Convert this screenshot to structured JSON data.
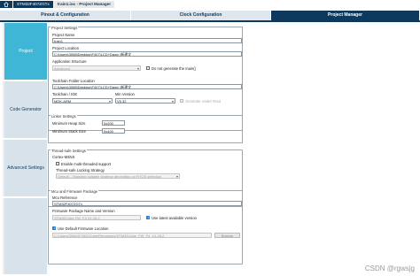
{
  "breadcrumb": {
    "device": "STM32F407ZGTx",
    "page": "train1.ioc - Project Manager"
  },
  "tabs": [
    {
      "label": "Pinout & Configuration"
    },
    {
      "label": "Clock Configuration"
    },
    {
      "label": "Project Manager"
    }
  ],
  "sidebar": {
    "items": [
      {
        "label": "Project"
      },
      {
        "label": "Code Generator"
      },
      {
        "label": "Advanced Settings"
      }
    ]
  },
  "project_settings": {
    "title": "Project Settings",
    "name_label": "Project Name",
    "name_value": "train1",
    "location_label": "Project Location",
    "location_value": "C:\\Users\\3068\\Desktop\\F407\\LCD+Dawy  \\新建文",
    "structure_label": "Application Structure",
    "structure_value": "Advanced",
    "no_main_label": "Do not generate the main()",
    "toolchain_folder_label": "Toolchain Folder Location",
    "toolchain_folder_value": "C:\\Users\\3068\\Desktop\\F407\\LCD+Dawy  \\新建文",
    "ide_label": "Toolchain / IDE",
    "ide_value": "MDK-ARM",
    "min_version_label": "Min Version",
    "min_version_value": "V5.32",
    "gen_root_label": "Generate Under Root"
  },
  "linker_settings": {
    "title": "Linker Settings",
    "heap_label": "Minimum Heap Size",
    "heap_value": "0x200",
    "stack_label": "Minimum Stack Size",
    "stack_value": "0x400"
  },
  "thread_safe": {
    "title": "Thread-safe Settings",
    "core_label": "Cortex-M4NS",
    "multithread_label": "Enable multi-threaded support",
    "locking_label": "Thread-safe Locking Strategy",
    "locking_value": "Default  –  Mapping suitable strategy depending on RTOS selection"
  },
  "mcu_firmware": {
    "title": "Mcu and Firmware Package",
    "mcu_ref_label": "Mcu Reference",
    "mcu_ref_value": "STM32F407ZGTx",
    "fw_name_label": "Firmware Package Name and Version",
    "fw_name_value": "STM32Cube FW_F4 V1.26.2",
    "latest_label": "Use latest available version",
    "default_loc_label": "Use Default Firmware Location",
    "fw_path_value": "C:/Users/3068/STM32Cube/Repository/STM32Cube_FW_F4_V1.26.2",
    "browse_label": "Browse"
  },
  "watermark": "CSDN @rgwsjg",
  "colors": {
    "brand": "#0d3a5c",
    "sidebar_active": "#3fb6d5",
    "sidebar": "#d8e2eb"
  }
}
